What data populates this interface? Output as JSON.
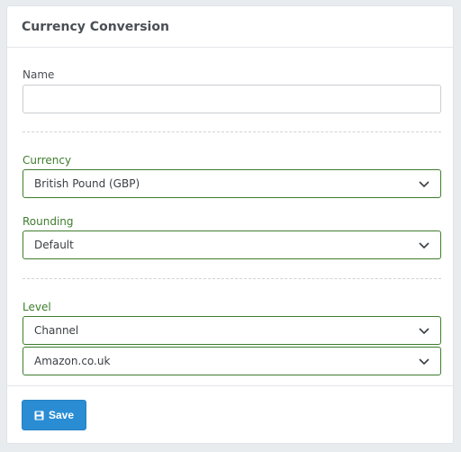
{
  "header": {
    "title": "Currency Conversion"
  },
  "form": {
    "name": {
      "label": "Name",
      "value": "",
      "placeholder": ""
    },
    "currency": {
      "label": "Currency",
      "selected": "British Pound (GBP)"
    },
    "rounding": {
      "label": "Rounding",
      "selected": "Default"
    },
    "level": {
      "label": "Level",
      "type_selected": "Channel",
      "channel_selected": "Amazon.co.uk"
    }
  },
  "footer": {
    "save_label": "Save"
  },
  "colors": {
    "accent_green": "#3e7d2d",
    "primary_blue": "#2a8dd4"
  },
  "icons": {
    "chevron": "chevron-down-icon",
    "save": "floppy-disk-icon"
  }
}
